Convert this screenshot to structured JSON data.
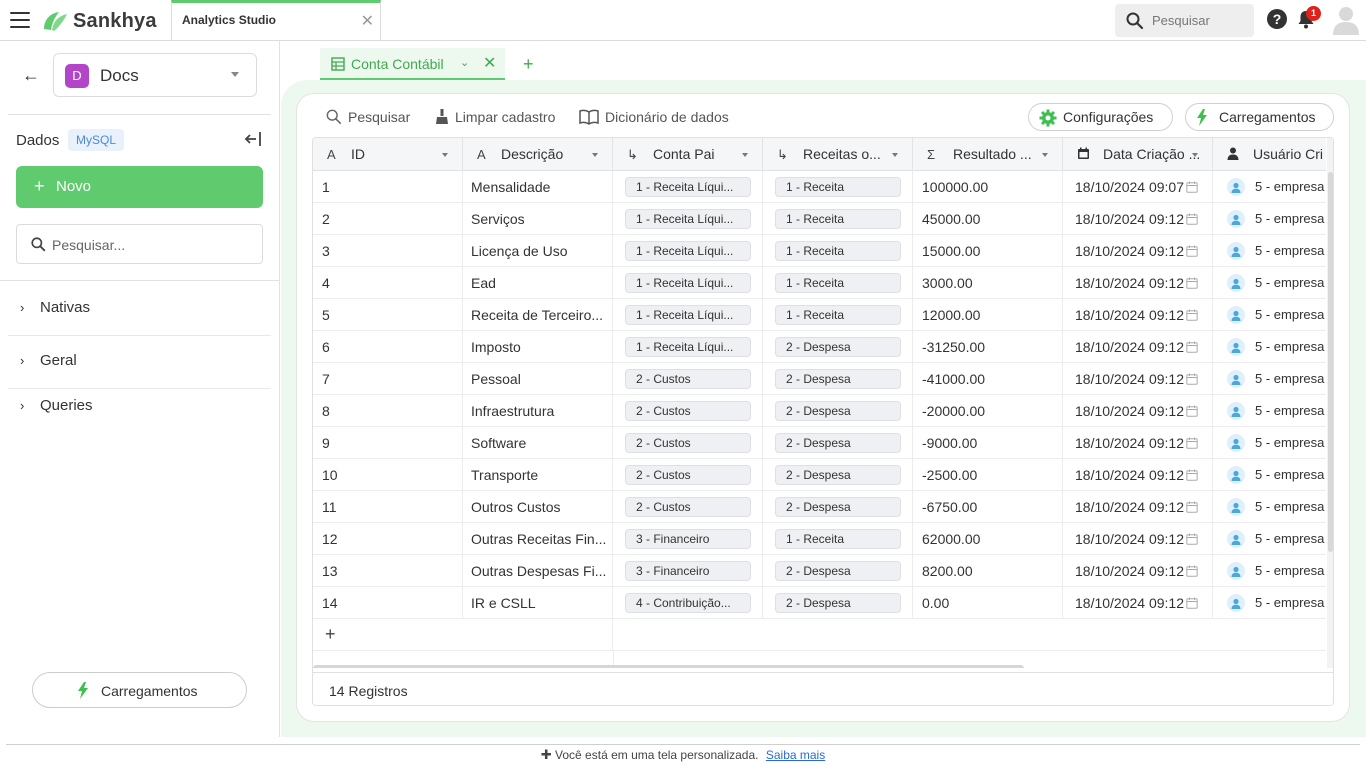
{
  "header": {
    "brand": "Sankhya",
    "app_tab": "Analytics Studio",
    "search_placeholder": "Pesquisar",
    "notification_count": "1"
  },
  "sidebar": {
    "workspace": "Docs",
    "workspace_initial": "D",
    "section_title": "Dados",
    "db_badge": "MySQL",
    "new_button": "Novo",
    "search_placeholder": "Pesquisar...",
    "tree": [
      "Nativas",
      "Geral",
      "Queries"
    ],
    "loads_button": "Carregamentos"
  },
  "tab": {
    "label": "Conta Contábil"
  },
  "toolbar": {
    "search": "Pesquisar",
    "clear": "Limpar cadastro",
    "dictionary": "Dicionário de dados",
    "settings": "Configurações",
    "loads": "Carregamentos"
  },
  "grid": {
    "columns": [
      {
        "type_icon": "A",
        "label": "ID"
      },
      {
        "type_icon": "A",
        "label": "Descrição"
      },
      {
        "type_icon": "↳",
        "label": "Conta Pai"
      },
      {
        "type_icon": "↳",
        "label": "Receitas o..."
      },
      {
        "type_icon": "Σ",
        "label": "Resultado ..."
      },
      {
        "type_icon": "calendar-icon",
        "label": "Data Criação ..."
      },
      {
        "type_icon": "user-icon",
        "label": "Usuário Cri"
      }
    ],
    "rows": [
      {
        "id": "1",
        "descricao": "Mensalidade",
        "conta_pai": "1 - Receita Líqui...",
        "receitas": "1 - Receita",
        "resultado": "100000.00",
        "data": "18/10/2024 09:07",
        "usuario": "5 - empresa"
      },
      {
        "id": "2",
        "descricao": "Serviços",
        "conta_pai": "1 - Receita Líqui...",
        "receitas": "1 - Receita",
        "resultado": "45000.00",
        "data": "18/10/2024 09:12",
        "usuario": "5 - empresa"
      },
      {
        "id": "3",
        "descricao": "Licença de Uso",
        "conta_pai": "1 - Receita Líqui...",
        "receitas": "1 - Receita",
        "resultado": "15000.00",
        "data": "18/10/2024 09:12",
        "usuario": "5 - empresa"
      },
      {
        "id": "4",
        "descricao": "Ead",
        "conta_pai": "1 - Receita Líqui...",
        "receitas": "1 - Receita",
        "resultado": "3000.00",
        "data": "18/10/2024 09:12",
        "usuario": "5 - empresa"
      },
      {
        "id": "5",
        "descricao": "Receita de Terceiro...",
        "conta_pai": "1 - Receita Líqui...",
        "receitas": "1 - Receita",
        "resultado": "12000.00",
        "data": "18/10/2024 09:12",
        "usuario": "5 - empresa"
      },
      {
        "id": "6",
        "descricao": "Imposto",
        "conta_pai": "1 - Receita Líqui...",
        "receitas": "2 - Despesa",
        "resultado": "-31250.00",
        "data": "18/10/2024 09:12",
        "usuario": "5 - empresa"
      },
      {
        "id": "7",
        "descricao": "Pessoal",
        "conta_pai": "2 - Custos",
        "receitas": "2 - Despesa",
        "resultado": "-41000.00",
        "data": "18/10/2024 09:12",
        "usuario": "5 - empresa"
      },
      {
        "id": "8",
        "descricao": "Infraestrutura",
        "conta_pai": "2 - Custos",
        "receitas": "2 - Despesa",
        "resultado": "-20000.00",
        "data": "18/10/2024 09:12",
        "usuario": "5 - empresa"
      },
      {
        "id": "9",
        "descricao": "Software",
        "conta_pai": "2 - Custos",
        "receitas": "2 - Despesa",
        "resultado": "-9000.00",
        "data": "18/10/2024 09:12",
        "usuario": "5 - empresa"
      },
      {
        "id": "10",
        "descricao": "Transporte",
        "conta_pai": "2 - Custos",
        "receitas": "2 - Despesa",
        "resultado": "-2500.00",
        "data": "18/10/2024 09:12",
        "usuario": "5 - empresa"
      },
      {
        "id": "11",
        "descricao": "Outros Custos",
        "conta_pai": "2 - Custos",
        "receitas": "2 - Despesa",
        "resultado": "-6750.00",
        "data": "18/10/2024 09:12",
        "usuario": "5 - empresa"
      },
      {
        "id": "12",
        "descricao": "Outras Receitas Fin...",
        "conta_pai": "3 - Financeiro",
        "receitas": "1 - Receita",
        "resultado": "62000.00",
        "data": "18/10/2024 09:12",
        "usuario": "5 - empresa"
      },
      {
        "id": "13",
        "descricao": "Outras Despesas Fi...",
        "conta_pai": "3 - Financeiro",
        "receitas": "2 - Despesa",
        "resultado": "8200.00",
        "data": "18/10/2024 09:12",
        "usuario": "5 - empresa"
      },
      {
        "id": "14",
        "descricao": "IR e CSLL",
        "conta_pai": "4 - Contribuição...",
        "receitas": "2 - Despesa",
        "resultado": "0.00",
        "data": "18/10/2024 09:12",
        "usuario": "5 - empresa"
      }
    ],
    "footer": "14 Registros"
  },
  "notice": {
    "text": "Você está em uma tela personalizada.",
    "link": "Saiba mais"
  },
  "colors": {
    "accent": "#5fca6e",
    "accent_text": "#3faa4f",
    "frame_bg": "#edf8ef",
    "badge_red": "#e0211b",
    "workspace_purple": "#b346c8"
  }
}
